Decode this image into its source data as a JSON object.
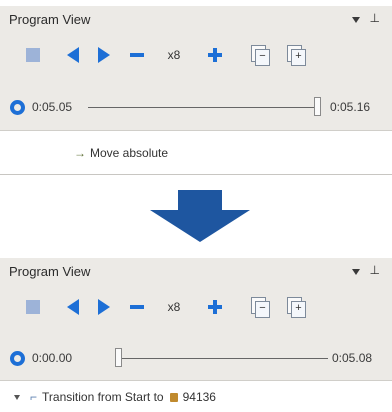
{
  "before": {
    "title": "Program View",
    "toolbar": {
      "speed_label": "x8"
    },
    "time_start": "0:05.05",
    "time_end": "0:05.16",
    "slider_position": 0.94,
    "list_item": "Move absolute"
  },
  "after": {
    "title": "Program View",
    "toolbar": {
      "speed_label": "x8"
    },
    "time_start": "0:00.00",
    "time_end": "0:05.08",
    "slider_position": 0.0,
    "list_item": {
      "prefix": "Transition from Start to",
      "target": "94136"
    }
  },
  "icons": {
    "stop": "stop-icon",
    "step_back": "step-back-icon",
    "play": "play-icon",
    "slower": "minus-icon",
    "faster": "plus-icon",
    "collapse_doc": "collapse-document-icon",
    "expand_doc": "expand-document-icon",
    "refresh": "refresh-icon",
    "dropdown": "dropdown-icon",
    "pin": "pin-icon",
    "transition_arrow": "down-arrow-icon"
  },
  "colors": {
    "accent_blue": "#1d6fd6",
    "stop_disabled": "#9db3d8",
    "panel_background": "#eceae6",
    "transition_arrow": "#1e56a0",
    "target_icon": "#c08a2e"
  }
}
